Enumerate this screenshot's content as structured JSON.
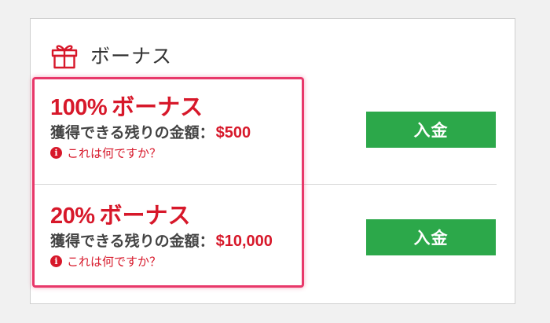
{
  "header": {
    "title": "ボーナス",
    "icon": "gift-icon"
  },
  "offers": [
    {
      "percent": "100%",
      "label": "ボーナス",
      "remaining_label": "獲得できる残りの金額：",
      "remaining_amount": "$500",
      "info_text": "これは何ですか？",
      "button_label": "入金"
    },
    {
      "percent": "20%",
      "label": "ボーナス",
      "remaining_label": "獲得できる残りの金額：",
      "remaining_amount": "$10,000",
      "info_text": "これは何ですか？",
      "button_label": "入金"
    }
  ],
  "colors": {
    "accent_red": "#d7182a",
    "button_green": "#2ca84a",
    "highlight_pink": "#e8386a"
  }
}
